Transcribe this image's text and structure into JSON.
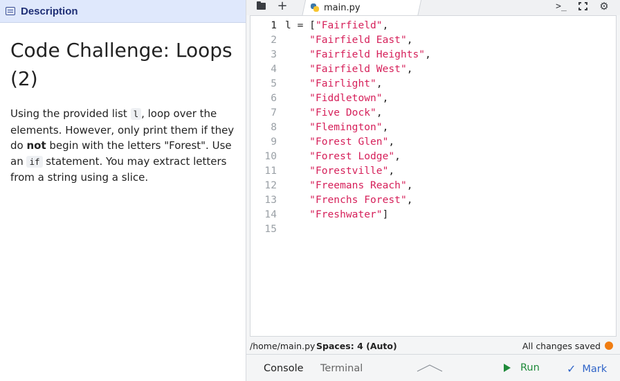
{
  "description_tab": {
    "label": "Description",
    "icon": "description-icon"
  },
  "challenge": {
    "title": "Code Challenge: Loops (2)",
    "text_1": "Using the provided list ",
    "code_1": "l",
    "text_2": ", loop over the elements. However, only print them if they do ",
    "bold": "not",
    "text_3": " begin with the letters \"Forest\". Use an ",
    "code_2": "if",
    "text_4": " statement. You may extract letters from a string using a slice."
  },
  "editor_tabs": {
    "file_name": "main.py",
    "icons": [
      "folder-icon",
      "plus-icon",
      "python-file-icon",
      "terminal-icon",
      "fullscreen-icon",
      "gear-icon"
    ]
  },
  "code": {
    "decl": "l = [",
    "items": [
      "\"Fairfield\"",
      "\"Fairfield East\"",
      "\"Fairfield Heights\"",
      "\"Fairfield West\"",
      "\"Fairlight\"",
      "\"Fiddletown\"",
      "\"Five Dock\"",
      "\"Flemington\"",
      "\"Forest Glen\"",
      "\"Forest Lodge\"",
      "\"Forestville\"",
      "\"Freemans Reach\"",
      "\"Frenchs Forest\"",
      "\"Freshwater\""
    ],
    "line_numbers": [
      "1",
      "2",
      "3",
      "4",
      "5",
      "6",
      "7",
      "8",
      "9",
      "10",
      "11",
      "12",
      "13",
      "14",
      "15"
    ],
    "comma": ",",
    "close": "]"
  },
  "status": {
    "path": "/home/main.py",
    "spaces": "Spaces: 4 (Auto)",
    "saved": "All changes saved",
    "saved_color": "#f07d12"
  },
  "bottom_bar": {
    "console": "Console",
    "terminal": "Terminal",
    "run": "Run",
    "mark": "Mark"
  },
  "colors": {
    "string": "#d6205a",
    "run": "#1f8a3a",
    "mark": "#2f64c8",
    "description_tab_bg": "#dfe8fc"
  }
}
